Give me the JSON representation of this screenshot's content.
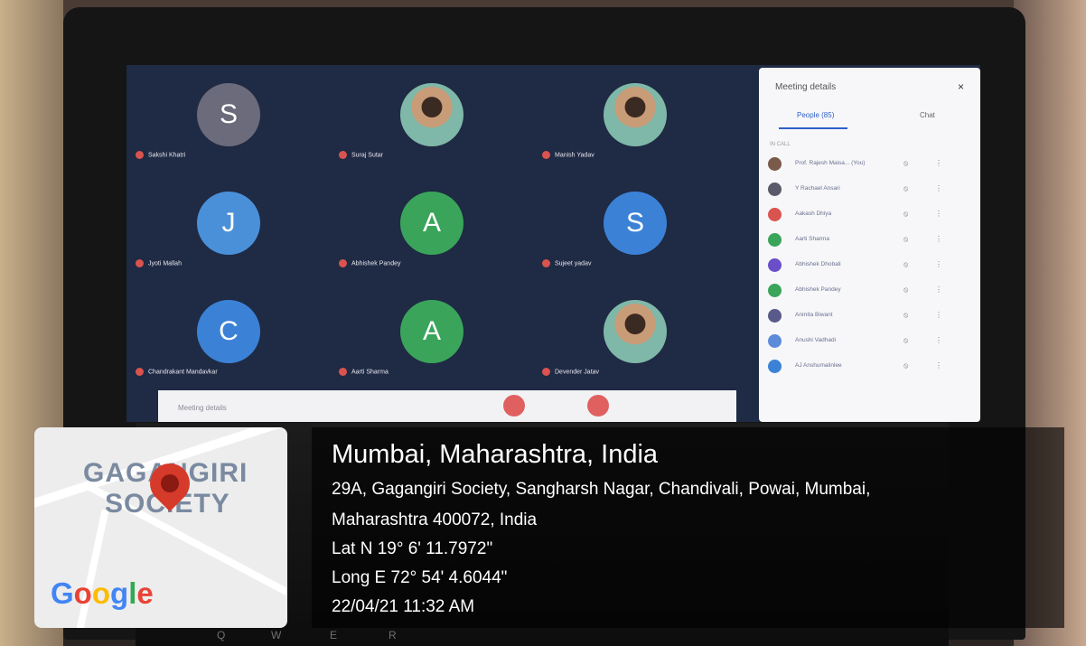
{
  "meeting": {
    "participants": [
      {
        "name": "Sakshi Khatri",
        "initial": "S",
        "color": "#6b6b7b",
        "photo": false
      },
      {
        "name": "Suraj Sutar",
        "initial": "",
        "color": "",
        "photo": true
      },
      {
        "name": "Manish Yadav",
        "initial": "",
        "color": "",
        "photo": true
      },
      {
        "name": "Jyoti Mallah",
        "initial": "J",
        "color": "#4a90d9",
        "photo": false
      },
      {
        "name": "Abhishek Pandey",
        "initial": "A",
        "color": "#3aa55a",
        "photo": false
      },
      {
        "name": "Sujeet yadav",
        "initial": "S",
        "color": "#3b82d6",
        "photo": false
      },
      {
        "name": "Chandrakant Mandavkar",
        "initial": "C",
        "color": "#3b82d6",
        "photo": false
      },
      {
        "name": "Aarti Sharma",
        "initial": "A",
        "color": "#3aa55a",
        "photo": false
      },
      {
        "name": "Devender Jatav",
        "initial": "",
        "color": "",
        "photo": true
      }
    ],
    "toolbar": {
      "details_label": "Meeting details"
    },
    "panel": {
      "title": "Meeting details",
      "close": "×",
      "people_tab": "People (85)",
      "chat_tab": "Chat",
      "section_label": "IN CALL",
      "people": [
        {
          "name": "Prof. Rajesh Maisa... (You)",
          "color": "#7a5a4a"
        },
        {
          "name": "Y Rachael Ansari",
          "color": "#5a5a6a"
        },
        {
          "name": "Aakash Dhiya",
          "color": "#d9534f"
        },
        {
          "name": "Aarti Sharma",
          "color": "#3aa55a"
        },
        {
          "name": "Abhishek Dhobali",
          "color": "#6a4fc9"
        },
        {
          "name": "Abhishek Pandey",
          "color": "#3aa55a"
        },
        {
          "name": "Anmita Biwant",
          "color": "#5a5a8a"
        },
        {
          "name": "Anushi Vadhadi",
          "color": "#5b8bd9"
        },
        {
          "name": "AJ Anshumalinlee",
          "color": "#3b82d6"
        }
      ]
    }
  },
  "map": {
    "label_line1": "GAGANGIRI",
    "label_line2": "SOCIETY",
    "brand": "Google"
  },
  "location": {
    "city": "Mumbai, Maharashtra, India",
    "address_line1": "29A, Gagangiri Society, Sangharsh Nagar, Chandivali, Powai, Mumbai,",
    "address_line2": "Maharashtra 400072, India",
    "lat": "Lat N 19° 6' 11.7972\"",
    "long": "Long E 72° 54' 4.6044\"",
    "timestamp": "22/04/21 11:32 AM"
  }
}
